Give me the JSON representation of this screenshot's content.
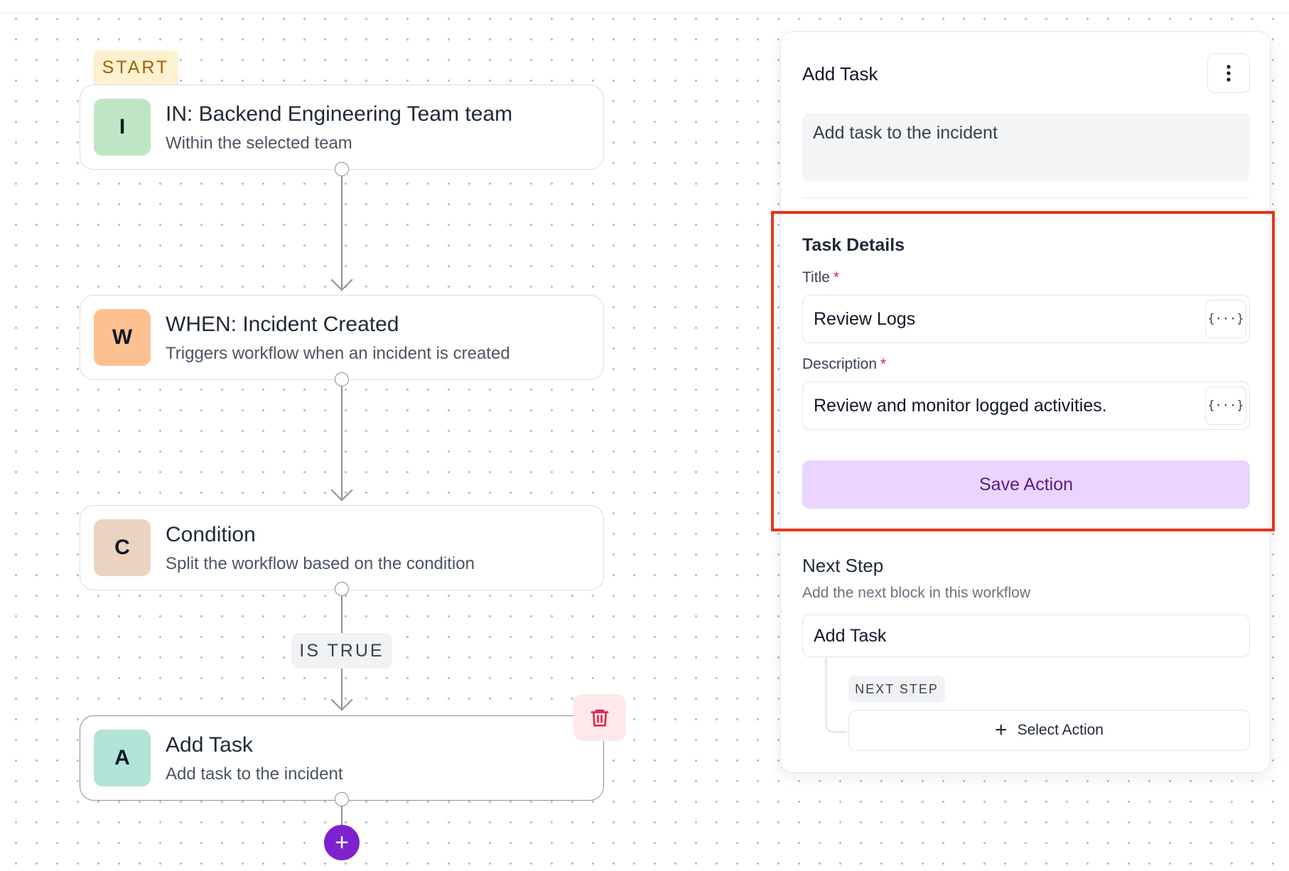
{
  "canvas": {
    "start_label": "START",
    "nodes": [
      {
        "letter": "I",
        "title": "IN: Backend Engineering Team team",
        "subtitle": "Within the selected team",
        "color": "#bfe6c4"
      },
      {
        "letter": "W",
        "title": "WHEN: Incident Created",
        "subtitle": "Triggers workflow when an incident is created",
        "color": "#fdc191"
      },
      {
        "letter": "C",
        "title": "Condition",
        "subtitle": "Split the workflow based on the condition",
        "color": "#ead3bf"
      },
      {
        "letter": "A",
        "title": "Add Task",
        "subtitle": "Add task to the incident",
        "color": "#b3e3d8"
      }
    ],
    "condition_label": "IS TRUE",
    "add_button": "+",
    "delete_icon": "trash-icon",
    "accent_color": "#7e22ce"
  },
  "panel": {
    "title": "Add Task",
    "menu_icon": "kebab-icon",
    "description": "Add task to the incident",
    "task_details": {
      "heading": "Task Details",
      "title_label": "Title",
      "title_value": "Review Logs",
      "description_label": "Description",
      "description_value": "Review and monitor logged activities.",
      "required_marker": "*",
      "variable_button": "{···}",
      "save_label": "Save Action"
    },
    "next_step": {
      "heading": "Next Step",
      "subtitle": "Add the next block in this workflow",
      "selected_block": "Add Task",
      "badge": "NEXT STEP",
      "select_action_label": "Select Action",
      "plus": "+"
    },
    "highlight_color": "#e8341c"
  }
}
